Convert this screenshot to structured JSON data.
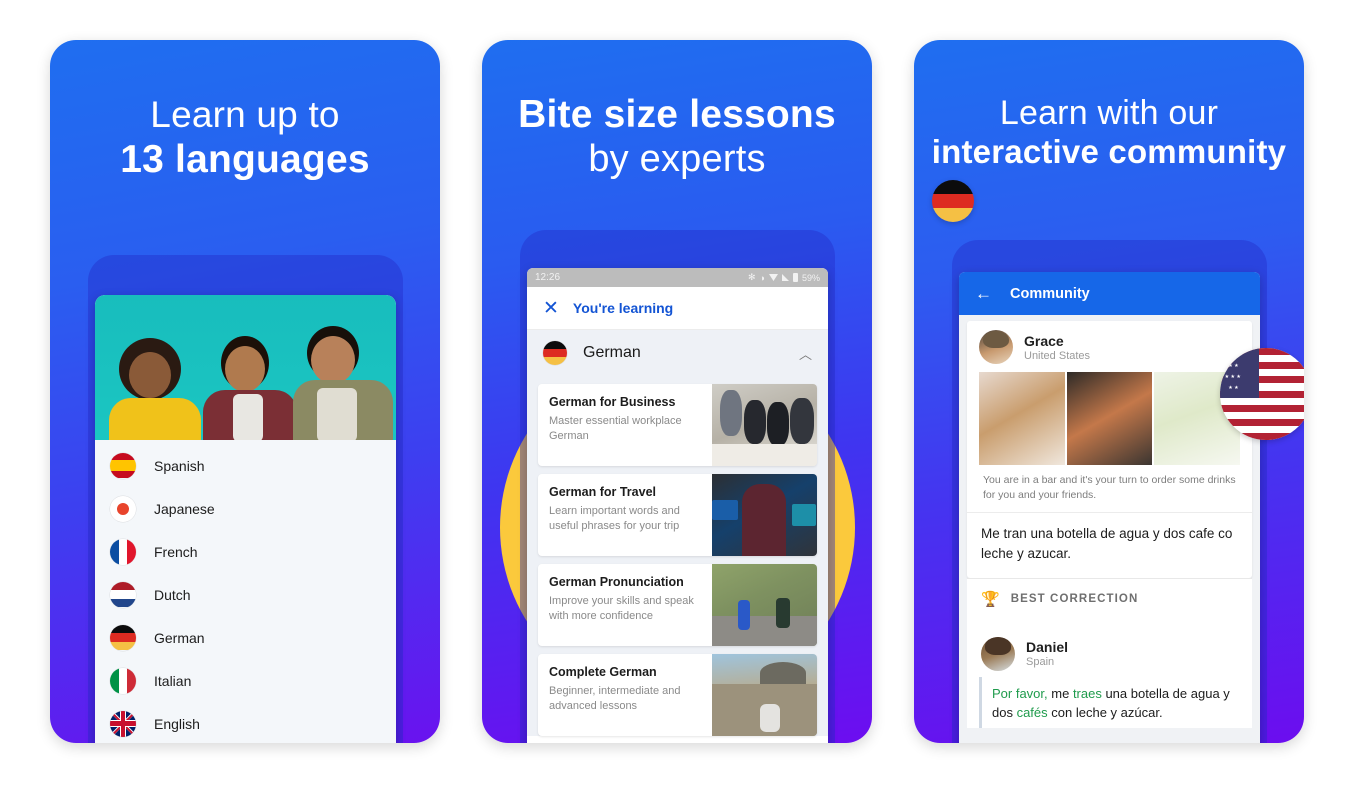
{
  "panels": [
    {
      "id": "languages",
      "headline_line1": "Learn up to",
      "headline_line2": "13 languages",
      "languages": [
        {
          "name": "Spanish",
          "flag": "spain-flag"
        },
        {
          "name": "Japanese",
          "flag": "japan-flag"
        },
        {
          "name": "French",
          "flag": "france-flag"
        },
        {
          "name": "Dutch",
          "flag": "netherlands-flag"
        },
        {
          "name": "German",
          "flag": "germany-flag"
        },
        {
          "name": "Italian",
          "flag": "italy-flag"
        },
        {
          "name": "English",
          "flag": "uk-flag"
        }
      ]
    },
    {
      "id": "lessons",
      "headline_line1": "Bite size lessons",
      "headline_line2": "by experts",
      "statusbar": {
        "time": "12:26",
        "battery": "59%"
      },
      "learning_bar": {
        "close_icon": "close-icon",
        "label": "You're learning"
      },
      "selected_language": {
        "name": "German",
        "flag": "germany-flag",
        "chevron": "chevron-up-icon"
      },
      "lessons": [
        {
          "title": "German for Business",
          "subtitle": "Master essential workplace German"
        },
        {
          "title": "German for Travel",
          "subtitle": "Learn important words and useful phrases for your trip"
        },
        {
          "title": "German Pronunciation",
          "subtitle": "Improve your skills and speak with more confidence"
        },
        {
          "title": "Complete German",
          "subtitle": "Beginner, intermediate and advanced lessons"
        }
      ]
    },
    {
      "id": "community",
      "headline_line1": "Learn with our",
      "headline_line2": "interactive community",
      "badge_flag": "germany-flag",
      "header": {
        "back_icon": "back-arrow-icon",
        "title": "Community"
      },
      "post": {
        "author": "Grace",
        "country": "United States",
        "country_flag": "usa-flag",
        "prompt": "You are in a bar and it's your turn to order some drinks for you and your friends.",
        "answer": "Me tran una botella de agua y dos cafe co leche y azucar."
      },
      "best_correction": {
        "label": "BEST CORRECTION",
        "trophy_icon": "trophy-icon",
        "author": "Daniel",
        "country": "Spain",
        "text_highlight": "Por favor,",
        "text_rest_1": " me ",
        "text_highlight_2": "traes",
        "text_rest_2": " una botella de agua y dos ",
        "text_highlight_3": "cafés",
        "text_rest_3": " con leche y azúcar."
      }
    }
  ],
  "colors": {
    "blue_top": "#1f6ef0",
    "purple_bottom": "#6a12ef",
    "accent_yellow": "#fbc93c",
    "link_blue": "#1354d4",
    "header_blue": "#1667e8",
    "teal_photo": "#18bdbd",
    "correct_green": "#1f9b4c"
  }
}
